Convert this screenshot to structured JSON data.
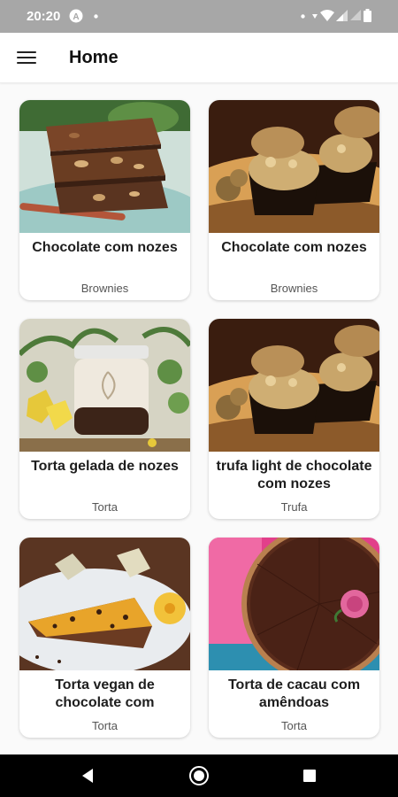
{
  "status_bar": {
    "time": "20:20"
  },
  "app_bar": {
    "title": "Home",
    "menu_icon": "hamburger-menu-icon"
  },
  "recipes": [
    {
      "name": "Chocolate com nozes",
      "category": "Brownies",
      "image": "brownie-photo"
    },
    {
      "name": "Chocolate com nozes",
      "category": "Brownies",
      "image": "walnut-truffles-photo"
    },
    {
      "name": "Torta gelada de nozes",
      "category": "Torta",
      "image": "jar-dessert-photo"
    },
    {
      "name": "trufa light de chocolate com nozes",
      "category": "Trufa",
      "image": "walnut-truffles-photo"
    },
    {
      "name": "Torta vegan de chocolate com",
      "category": "Torta",
      "image": "vegan-tart-slice-photo"
    },
    {
      "name": "Torta de cacau com amêndoas",
      "category": "Torta",
      "image": "cacao-cake-photo"
    }
  ],
  "nav_bar": {
    "back_icon": "back-triangle-icon",
    "home_icon": "home-circle-icon",
    "recents_icon": "recents-square-icon"
  },
  "colors": {
    "status_bar": "#a7a7a7",
    "app_bar": "#ffffff",
    "background": "#fafafa",
    "nav_bar": "#000000"
  }
}
